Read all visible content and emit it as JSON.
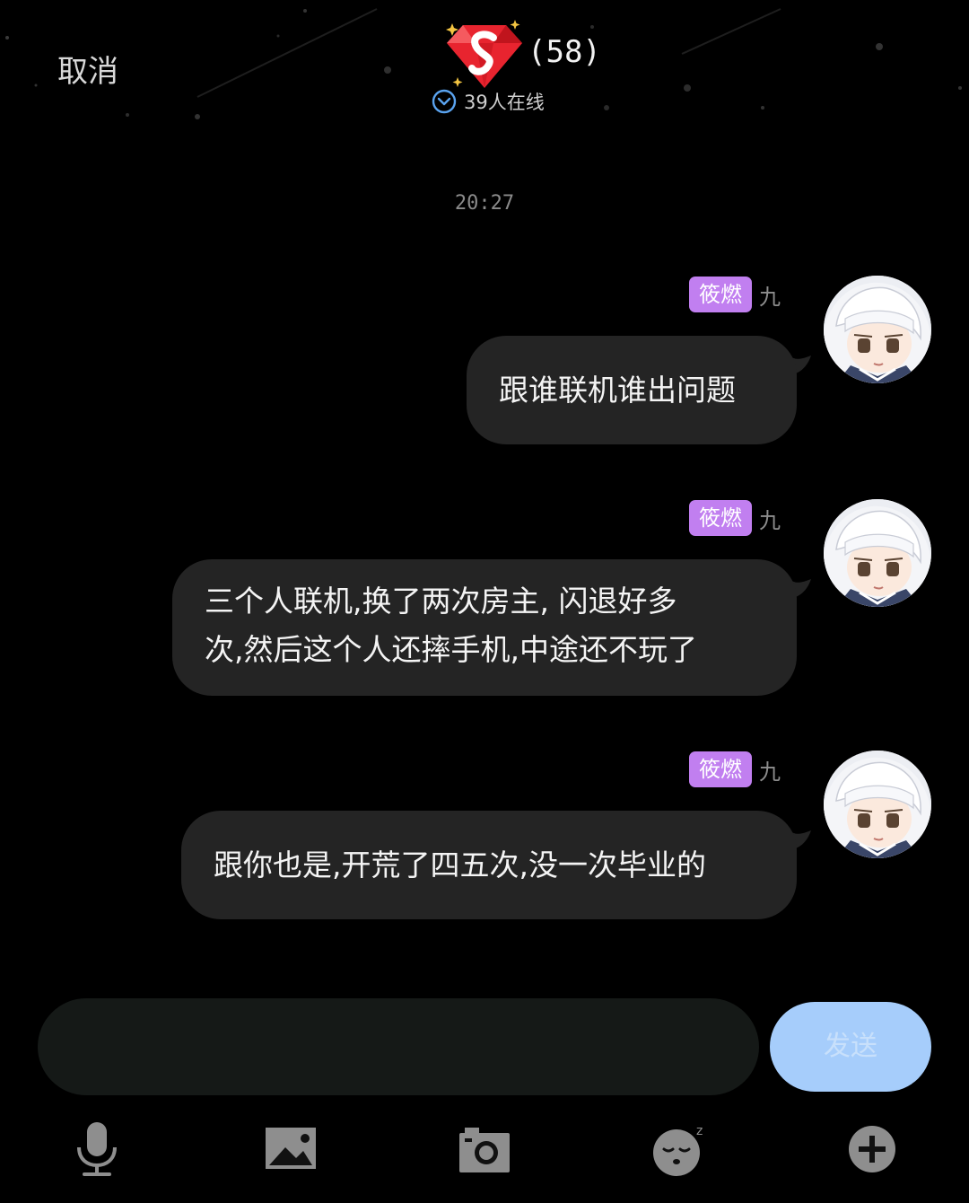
{
  "header": {
    "cancel_label": "取消",
    "member_count": "(58)",
    "online_text": "39人在线",
    "logo_icon": "red-diamond-s-logo"
  },
  "chat": {
    "timestamp": "20:27",
    "messages": [
      {
        "tag": "筱燃",
        "nickname": "九",
        "text": "跟谁联机谁出问题"
      },
      {
        "tag": "筱燃",
        "nickname": "九",
        "text": "三个人联机,换了两次房主, 闪退好多\n次,然后这个人还摔手机,中途还不玩了"
      },
      {
        "tag": "筱燃",
        "nickname": "九",
        "text": "跟你也是,开荒了四五次,没一次毕业的"
      }
    ]
  },
  "composer": {
    "input_value": "",
    "send_label": "发送"
  },
  "toolbar": {
    "icons": [
      "microphone-icon",
      "image-icon",
      "camera-icon",
      "emoji-icon",
      "plus-icon"
    ]
  },
  "colors": {
    "background": "#000000",
    "bubble": "#242424",
    "tag": "#c17ff0",
    "send_button": "#a6cdfb",
    "input": "#151917"
  }
}
